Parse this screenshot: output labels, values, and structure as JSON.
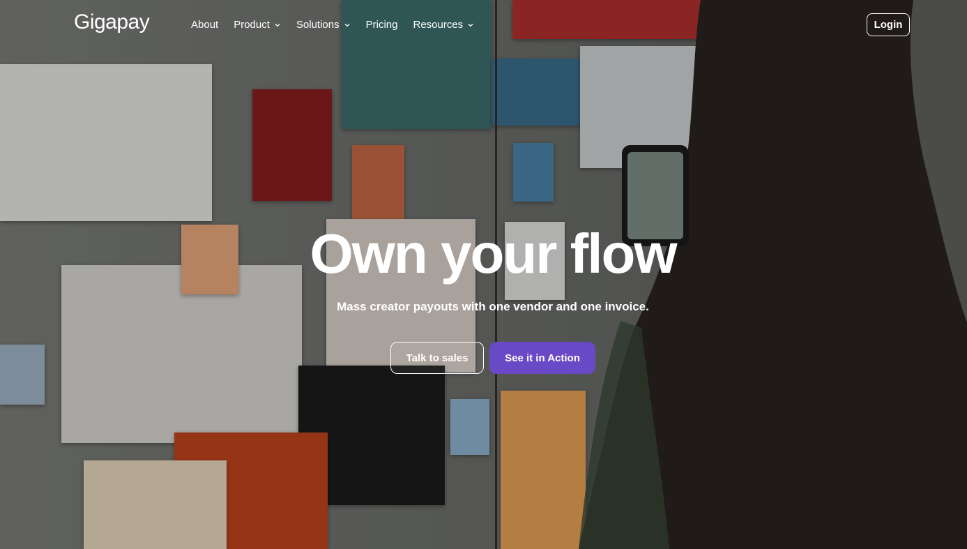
{
  "nav": {
    "logo": "Gigapay",
    "items": [
      {
        "label": "About",
        "has_dropdown": false
      },
      {
        "label": "Product",
        "has_dropdown": true
      },
      {
        "label": "Solutions",
        "has_dropdown": true
      },
      {
        "label": "Pricing",
        "has_dropdown": false
      },
      {
        "label": "Resources",
        "has_dropdown": true
      }
    ],
    "login_label": "Login"
  },
  "hero": {
    "title": "Own your flow",
    "subtitle": "Mass creator payouts with one vendor and one invoice.",
    "cta_secondary": "Talk to sales",
    "cta_primary": "See it in Action"
  },
  "colors": {
    "primary_button": "#6a49c6",
    "text": "#ffffff"
  },
  "icons": {
    "dropdown": "chevron-down-icon"
  }
}
